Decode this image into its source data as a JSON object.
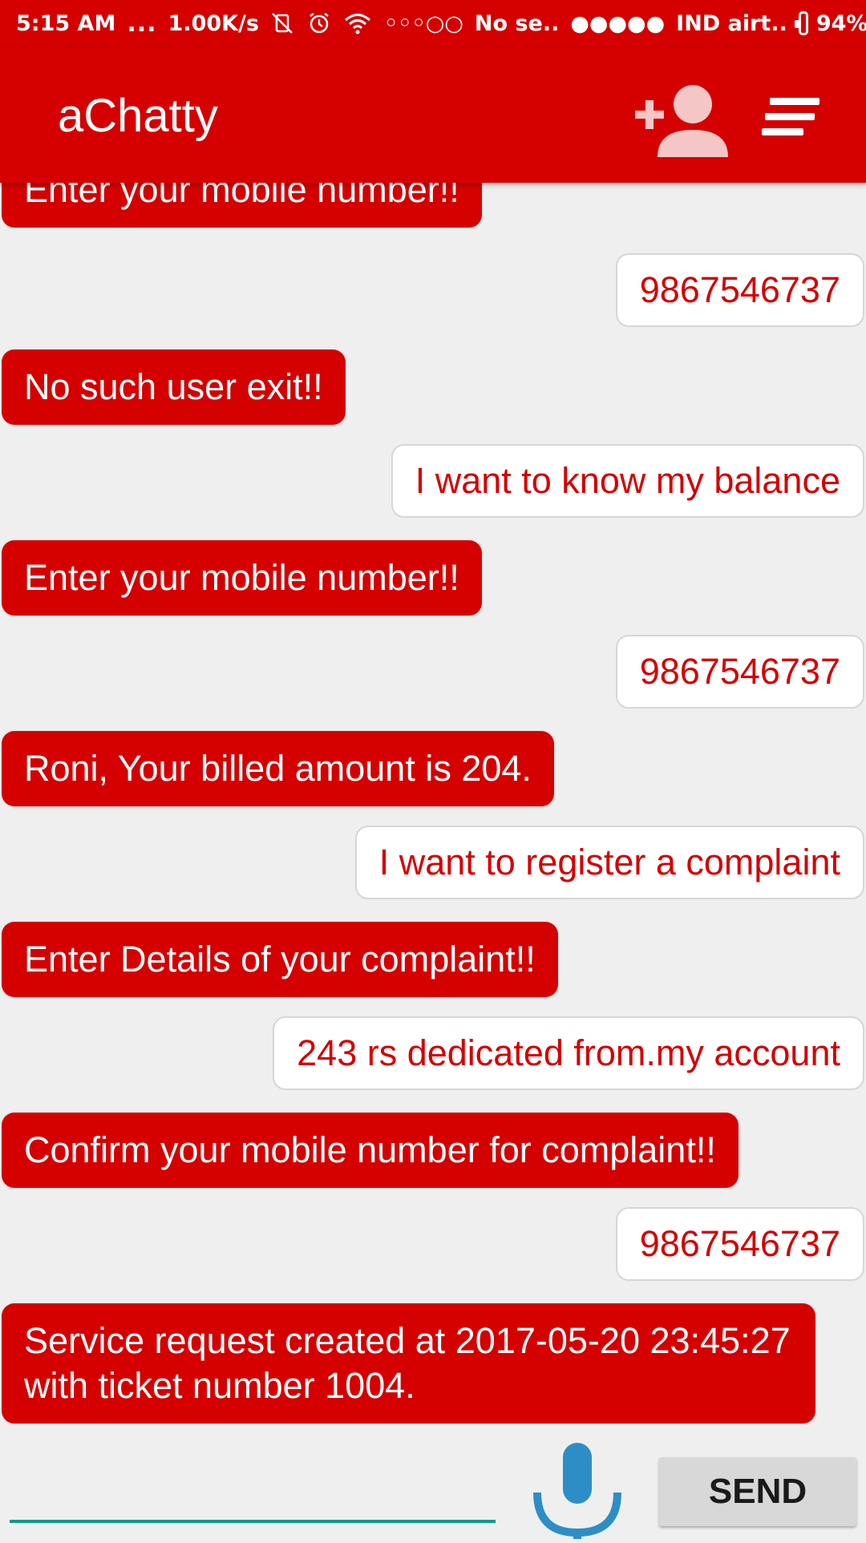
{
  "status_bar": {
    "time": "5:15 AM",
    "more": "...",
    "speed": "1.00K/s",
    "sim1_signal": "◦◦◦○○",
    "sim1_label": "No se..",
    "sim2_signal": "●●●●●",
    "sim2_label": "IND airt..",
    "battery_percent": "94%",
    "battery_level": 0.94,
    "icons": [
      "vibrate-off-icon",
      "alarm-icon",
      "wifi-icon",
      "battery-icon"
    ]
  },
  "app_bar": {
    "title": "aChatty",
    "color": "#d50000",
    "icons": [
      "add-user-icon",
      "menu-icon"
    ]
  },
  "messages": [
    {
      "from": "bot",
      "text": "Enter your mobile number!!"
    },
    {
      "from": "user",
      "text": "9867546737"
    },
    {
      "from": "bot",
      "text": "No such user exit!!"
    },
    {
      "from": "user",
      "text": "I want to know my balance"
    },
    {
      "from": "bot",
      "text": "Enter your mobile number!!"
    },
    {
      "from": "user",
      "text": "9867546737"
    },
    {
      "from": "bot",
      "text": "Roni, Your billed amount is 204."
    },
    {
      "from": "user",
      "text": "I want to register a complaint"
    },
    {
      "from": "bot",
      "text": "Enter Details of your complaint!!"
    },
    {
      "from": "user",
      "text": "243 rs dedicated from.my account"
    },
    {
      "from": "bot",
      "text": "Confirm your mobile number for complaint!!"
    },
    {
      "from": "user",
      "text": "9867546737"
    },
    {
      "from": "bot",
      "text": "Service request created at 2017-05-20 23:45:27 with ticket number 1004."
    }
  ],
  "composer": {
    "input_value": "",
    "send_label": "SEND",
    "mic_icon": "microphone-icon",
    "mic_color": "#2d8ec6",
    "underline_color": "#139a8a"
  }
}
